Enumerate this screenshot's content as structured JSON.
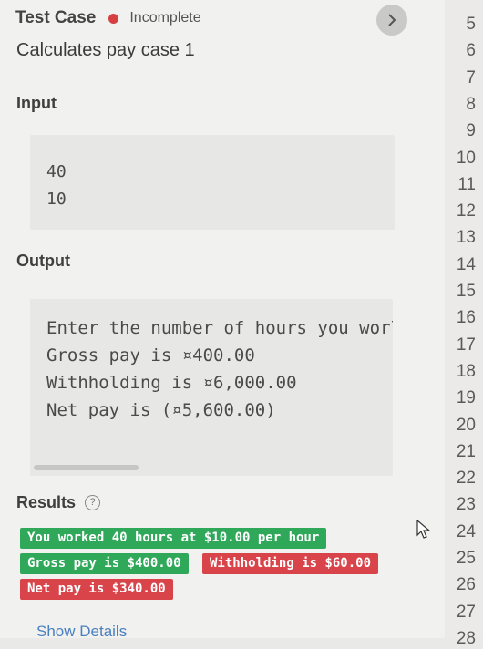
{
  "header": {
    "title": "Test Case",
    "status": "Incomplete",
    "status_color": "#d64040",
    "toggle_icon": "chevron-right-icon"
  },
  "subtitle": "Calculates pay case 1",
  "input": {
    "label": "Input",
    "lines": [
      "40",
      "10"
    ]
  },
  "output": {
    "label": "Output",
    "lines": [
      "Enter the number of hours you worl",
      "Gross pay is ¤400.00",
      "Withholding is ¤6,000.00",
      "Net pay is (¤5,600.00)"
    ]
  },
  "results": {
    "label": "Results",
    "help_icon": "question-circle-icon",
    "badges": [
      {
        "text": "You worked 40 hours at $10.00 per hour",
        "status": "pass",
        "color": "#2fa85a"
      },
      {
        "text": "Gross pay is $400.00",
        "status": "pass",
        "color": "#2fa85a"
      },
      {
        "text": "Withholding is $60.00",
        "status": "fail",
        "color": "#d9444b"
      },
      {
        "text": "Net pay is $340.00",
        "status": "fail",
        "color": "#d9444b"
      }
    ]
  },
  "show_details": "Show Details",
  "line_numbers": [
    "5",
    "6",
    "7",
    "8",
    "9",
    "10",
    "11",
    "12",
    "13",
    "14",
    "15",
    "16",
    "17",
    "18",
    "19",
    "20",
    "21",
    "22",
    "23",
    "24",
    "25",
    "26",
    "27",
    "28"
  ]
}
